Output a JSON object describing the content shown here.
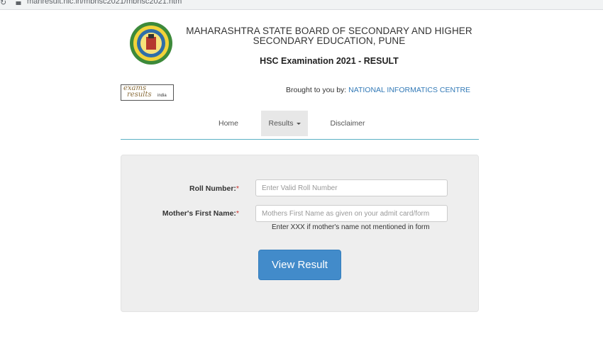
{
  "browser": {
    "url": "mahresult.nic.in/mbhsc2021/mbhsc2021.htm"
  },
  "header": {
    "board_name": "MAHARASHTRA STATE BOARD OF SECONDARY AND HIGHER SECONDARY EDUCATION, PUNE",
    "exam_title": "HSC Examination 2021 - RESULT",
    "logo_icon": "board-emblem-icon"
  },
  "partner": {
    "logo_line1": "exams",
    "logo_line2": "results",
    "logo_line3": "india",
    "brought_prefix": "Brought to you by:",
    "brought_org": "NATIONAL INFORMATICS CENTRE"
  },
  "nav": {
    "items": [
      {
        "label": "Home"
      },
      {
        "label": "Results"
      },
      {
        "label": "Disclaimer"
      }
    ],
    "active": "Results"
  },
  "form": {
    "roll_label": "Roll Number:",
    "roll_placeholder": "Enter Valid Roll Number",
    "mother_label": "Mother's First Name:",
    "mother_placeholder": "Mothers First Name as given on your admit card/form",
    "required_mark": "*",
    "mother_help": "Enter XXX if mother's name not mentioned in form",
    "submit_label": "View Result"
  },
  "colors": {
    "primary_button": "#428bca",
    "link": "#337ab7",
    "nav_underline": "#5bb0c4",
    "panel_bg": "#eeeeee"
  }
}
